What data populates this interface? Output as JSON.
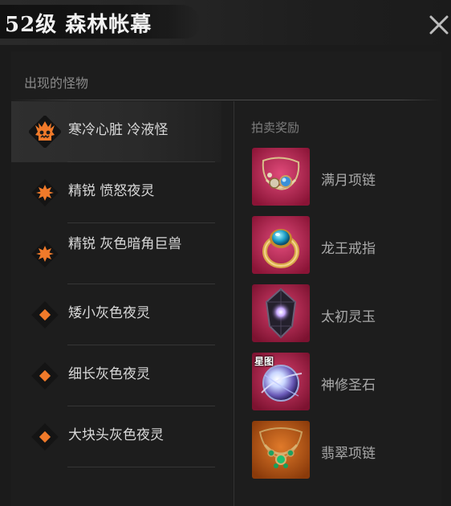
{
  "header": {
    "title": "52级 森林帐幕"
  },
  "monster_section": {
    "title": "出现的怪物",
    "items": [
      {
        "name": "寒冷心脏 冷液怪",
        "icon": "boss-skull-icon",
        "selected": true
      },
      {
        "name": "精锐 愤怒夜灵",
        "icon": "elite-star-icon"
      },
      {
        "name": "精锐 灰色暗角巨兽",
        "icon": "elite-star-icon"
      },
      {
        "name": "矮小灰色夜灵",
        "icon": "normal-diamond-icon"
      },
      {
        "name": "细长灰色夜灵",
        "icon": "normal-diamond-icon"
      },
      {
        "name": "大块头灰色夜灵",
        "icon": "normal-diamond-icon"
      }
    ]
  },
  "reward_section": {
    "title": "拍卖奖励",
    "items": [
      {
        "name": "满月项链",
        "icon": "necklace-icon",
        "tag": ""
      },
      {
        "name": "龙王戒指",
        "icon": "ring-icon",
        "tag": ""
      },
      {
        "name": "太初灵玉",
        "icon": "dark-crystal-icon",
        "tag": ""
      },
      {
        "name": "神修圣石",
        "icon": "orb-icon",
        "tag": "星图"
      },
      {
        "name": "翡翠项链",
        "icon": "emerald-necklace-icon",
        "tag": ""
      }
    ]
  },
  "colors": {
    "accent_orange": "#f07a2a",
    "reward_bg_red": "#c22150",
    "reward_bg_orange": "#c25a12"
  }
}
